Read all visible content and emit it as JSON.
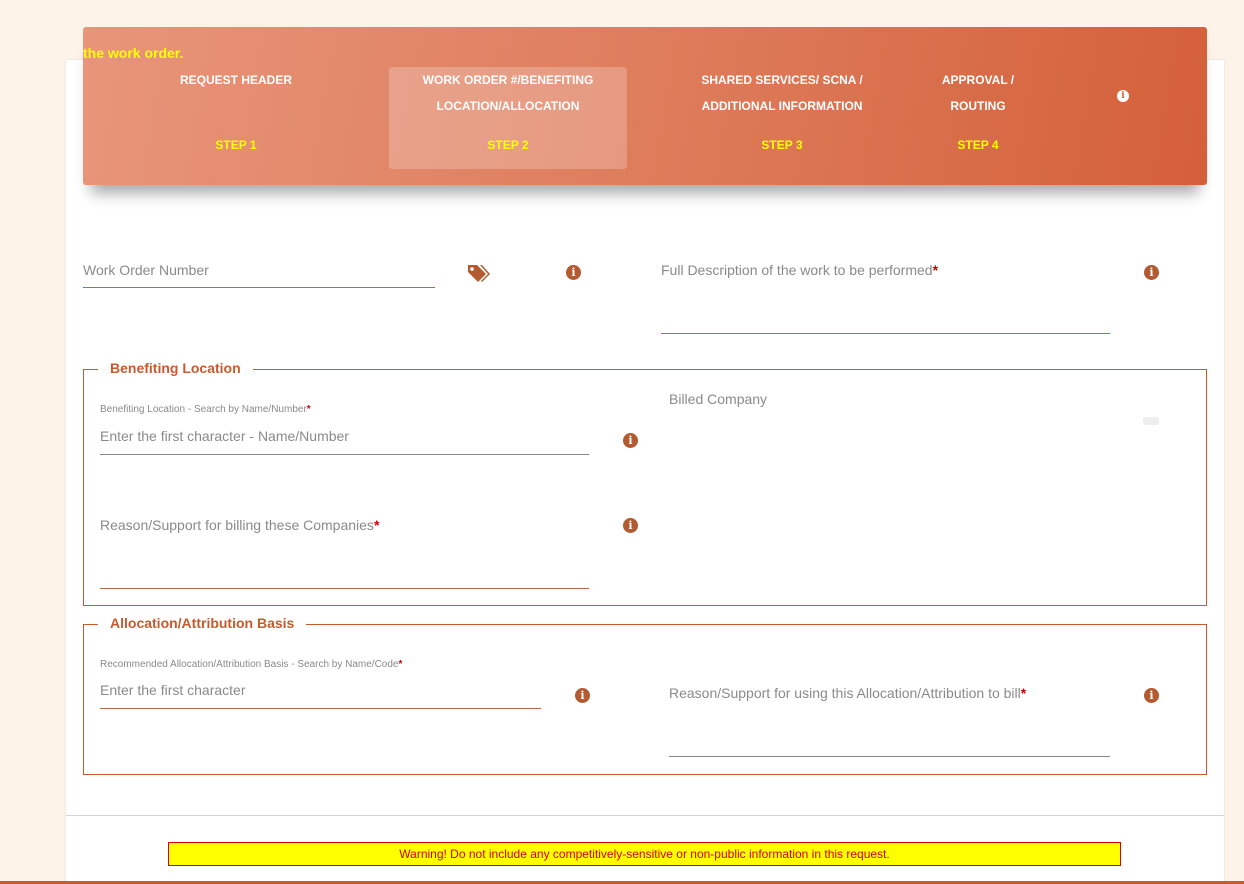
{
  "wizard": {
    "note": "the work order.",
    "steps": [
      {
        "line1": "REQUEST HEADER",
        "line2": "",
        "step": "STEP 1"
      },
      {
        "line1": "WORK ORDER #/BENEFITING",
        "line2": "LOCATION/ALLOCATION",
        "step": "STEP 2"
      },
      {
        "line1": "SHARED SERVICES/ SCNA /",
        "line2": "ADDITIONAL INFORMATION",
        "step": "STEP 3"
      },
      {
        "line1": "APPROVAL /",
        "line2": "ROUTING",
        "step": "STEP 4"
      }
    ],
    "active_step": 2,
    "info_icon": "info-circle-icon"
  },
  "form": {
    "work_order_number": {
      "placeholder": "Work Order Number",
      "icon": "tags-icon"
    },
    "full_description": {
      "label": "Full Description of the work to be performed",
      "required": "*"
    },
    "benefiting_location": {
      "legend": "Benefiting Location",
      "search_label": "Benefiting Location - Search by Name/Number",
      "search_required": "*",
      "search_placeholder": "Enter the first character - Name/Number",
      "billed_company_label": "Billed Company",
      "reason_label": "Reason/Support for billing these Companies",
      "reason_required": "*"
    },
    "allocation": {
      "legend": "Allocation/Attribution Basis",
      "search_label": "Recommended Allocation/Attribution Basis - Search by Name/Code",
      "search_required": "*",
      "search_placeholder": "Enter the first character",
      "reason_label": "Reason/Support for using this Allocation/Attribution to bill",
      "reason_required": "*"
    }
  },
  "warning": "Warning! Do not include any competitively-sensitive or non-public information in this request.",
  "colors": {
    "accent": "#c85a2e",
    "wizard_start": "#e8957a",
    "wizard_end": "#d4603a",
    "step_number": "#ffff00",
    "required": "#cc0000",
    "warning_bg": "#ffff00"
  }
}
